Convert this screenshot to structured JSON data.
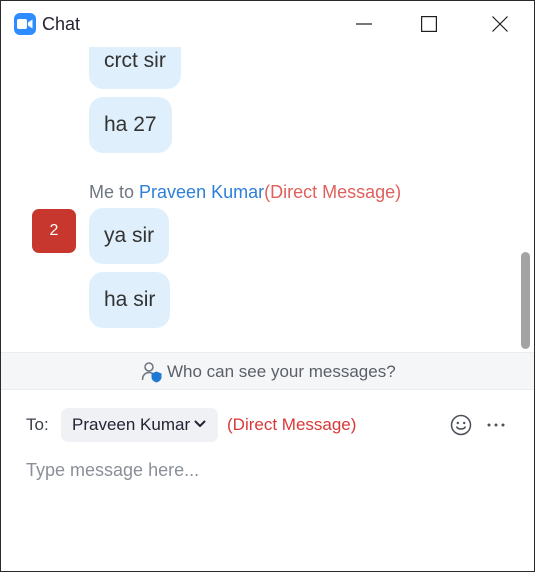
{
  "window": {
    "title": "Chat",
    "icons": {
      "app": "zoom-video-camera-icon",
      "minimize": "minimize-icon",
      "maximize": "maximize-icon",
      "close": "close-icon"
    }
  },
  "messages": [
    {
      "text": "crct sir"
    },
    {
      "text": "ha 27"
    },
    {
      "text": "ya sir"
    },
    {
      "text": "ha sir"
    }
  ],
  "sender_header": {
    "prefix": "Me to ",
    "recipient": "Praveen Kumar",
    "type": "(Direct Message)"
  },
  "unread_badge": {
    "count": "2",
    "color": "#c8372d"
  },
  "visibility_info": {
    "text": "Who can see your messages?",
    "icon": "user-shield-icon"
  },
  "composer": {
    "to_label": "To:",
    "recipient": "Praveen Kumar",
    "message_type": "(Direct Message)",
    "placeholder": "Type message here...",
    "value": "",
    "icons": {
      "recipient_dropdown": "chevron-down-icon",
      "emoji": "emoji-icon",
      "more": "more-options-icon"
    }
  },
  "colors": {
    "accent_blue": "#2d8cff",
    "bubble_bg": "#dff0fc",
    "recipient_name": "#2d7fd8",
    "direct_message": "#e0605c"
  }
}
